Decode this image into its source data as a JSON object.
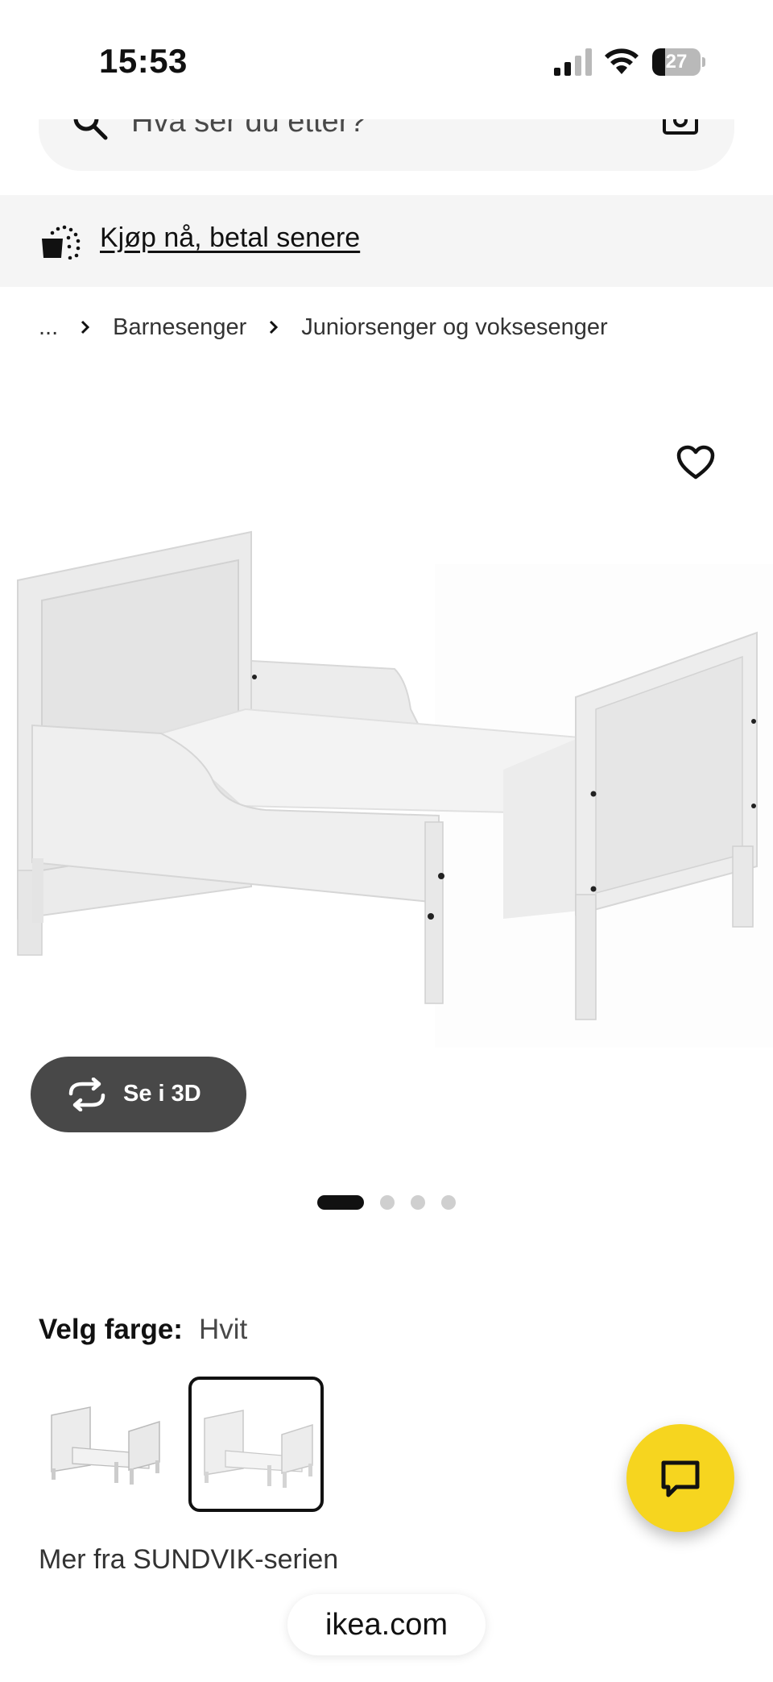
{
  "status_bar": {
    "time": "15:53",
    "battery_level": "27",
    "battery_fraction": 0.27,
    "icons": [
      "signal-icon",
      "wifi-icon",
      "battery-icon"
    ]
  },
  "search": {
    "placeholder": "Hva ser du etter?",
    "icons": [
      "search-icon",
      "camera-icon"
    ]
  },
  "promo": {
    "text": "Kjøp nå, betal senere",
    "icon": "basket-icon"
  },
  "breadcrumb": {
    "ellipsis": "...",
    "items": [
      "Barnesenger",
      "Juniorsenger og voksesenger"
    ]
  },
  "product": {
    "favorite_icon": "heart-icon",
    "view_3d_label": "Se i 3D",
    "carousel": {
      "total": 4,
      "active_index": 0
    }
  },
  "color": {
    "label": "Velg farge:",
    "value": "Hvit",
    "selected_index": 1
  },
  "series_link": "Mer fra SUNDVIK-serien",
  "chat": {
    "icon": "chat-icon",
    "color": "#f6d51f"
  },
  "browser": {
    "url": "ikea.com"
  }
}
